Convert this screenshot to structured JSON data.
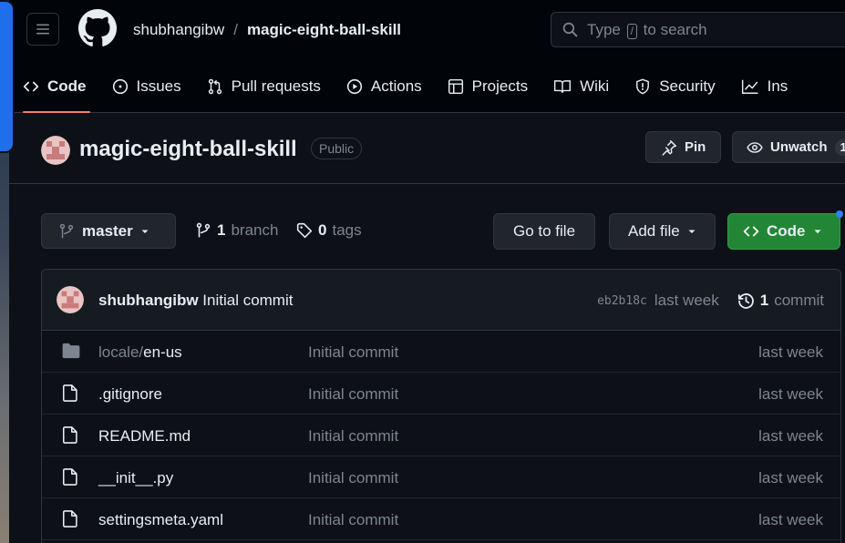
{
  "colors": {
    "bg": "#0d1117",
    "header_bg": "#010409",
    "border": "#30363d",
    "text": "#e6edf3",
    "muted": "#7d8590",
    "accent_tab": "#f78166",
    "code_button": "#238636",
    "notification_dot": "#2f81f7"
  },
  "header": {
    "owner": "shubhangibw",
    "separator": "/",
    "repo": "magic-eight-ball-skill",
    "search": {
      "prefix": "Type",
      "key": "/",
      "suffix": "to search"
    }
  },
  "tabs": [
    {
      "label": "Code",
      "icon": "code-icon",
      "active": true
    },
    {
      "label": "Issues",
      "icon": "issue-icon"
    },
    {
      "label": "Pull requests",
      "icon": "pull-request-icon"
    },
    {
      "label": "Actions",
      "icon": "play-icon"
    },
    {
      "label": "Projects",
      "icon": "table-icon"
    },
    {
      "label": "Wiki",
      "icon": "book-icon"
    },
    {
      "label": "Security",
      "icon": "shield-icon"
    },
    {
      "label": "Ins",
      "icon": "graph-icon"
    }
  ],
  "repo": {
    "name": "magic-eight-ball-skill",
    "visibility": "Public",
    "pin_label": "Pin",
    "watch_label": "Unwatch",
    "watch_count": "1"
  },
  "toolbar": {
    "branch": "master",
    "branch_count": "1",
    "branch_word": "branch",
    "tag_count": "0",
    "tag_word": "tags",
    "goto_label": "Go to file",
    "addfile_label": "Add file",
    "code_label": "Code"
  },
  "commit": {
    "author": "shubhangibw",
    "message": "Initial commit",
    "sha": "eb2b18c",
    "date": "last week",
    "count": "1",
    "count_word": "commit"
  },
  "files": [
    {
      "type": "dir",
      "prefix": "locale/",
      "name": "en-us",
      "message": "Initial commit",
      "date": "last week"
    },
    {
      "type": "file",
      "prefix": "",
      "name": ".gitignore",
      "message": "Initial commit",
      "date": "last week"
    },
    {
      "type": "file",
      "prefix": "",
      "name": "README.md",
      "message": "Initial commit",
      "date": "last week"
    },
    {
      "type": "file",
      "prefix": "",
      "name": "__init__.py",
      "message": "Initial commit",
      "date": "last week"
    },
    {
      "type": "file",
      "prefix": "",
      "name": "settingsmeta.yaml",
      "message": "Initial commit",
      "date": "last week"
    }
  ]
}
